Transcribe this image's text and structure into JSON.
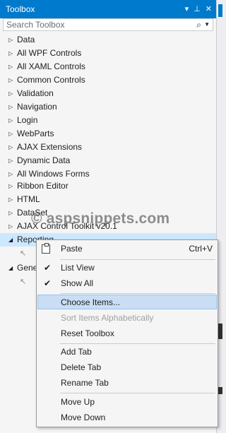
{
  "window": {
    "title": "Toolbox"
  },
  "title_icons": [
    "▾",
    "⊥",
    "✕"
  ],
  "search": {
    "placeholder": "Search Toolbox"
  },
  "categories": [
    {
      "label": "Data",
      "expanded": false
    },
    {
      "label": "All WPF Controls",
      "expanded": false
    },
    {
      "label": "All XAML Controls",
      "expanded": false
    },
    {
      "label": "Common Controls",
      "expanded": false
    },
    {
      "label": "Validation",
      "expanded": false
    },
    {
      "label": "Navigation",
      "expanded": false
    },
    {
      "label": "Login",
      "expanded": false
    },
    {
      "label": "WebParts",
      "expanded": false
    },
    {
      "label": "AJAX Extensions",
      "expanded": false
    },
    {
      "label": "Dynamic Data",
      "expanded": false
    },
    {
      "label": "All Windows Forms",
      "expanded": false
    },
    {
      "label": "Ribbon Editor",
      "expanded": false
    },
    {
      "label": "HTML",
      "expanded": false
    },
    {
      "label": "DataSet",
      "expanded": false
    },
    {
      "label": "AJAX Control Toolkit v20.1",
      "expanded": false
    },
    {
      "label": "Reporting",
      "expanded": true,
      "selected": true
    },
    {
      "label": "General",
      "expanded": true
    }
  ],
  "watermark": "© aspsnippets.com",
  "context_menu": {
    "paste": {
      "label": "Paste",
      "shortcut": "Ctrl+V"
    },
    "list_view": {
      "label": "List View",
      "checked": true
    },
    "show_all": {
      "label": "Show All",
      "checked": true
    },
    "choose_items": {
      "label": "Choose Items..."
    },
    "sort_items": {
      "label": "Sort Items Alphabetically",
      "disabled": true
    },
    "reset_toolbox": {
      "label": "Reset Toolbox"
    },
    "add_tab": {
      "label": "Add Tab"
    },
    "delete_tab": {
      "label": "Delete Tab"
    },
    "rename_tab": {
      "label": "Rename Tab"
    },
    "move_up": {
      "label": "Move Up"
    },
    "move_down": {
      "label": "Move Down"
    }
  },
  "colors": {
    "titlebar": "#007acc",
    "selected_row": "#cce8ff",
    "menu_highlight": "#c9def5"
  }
}
